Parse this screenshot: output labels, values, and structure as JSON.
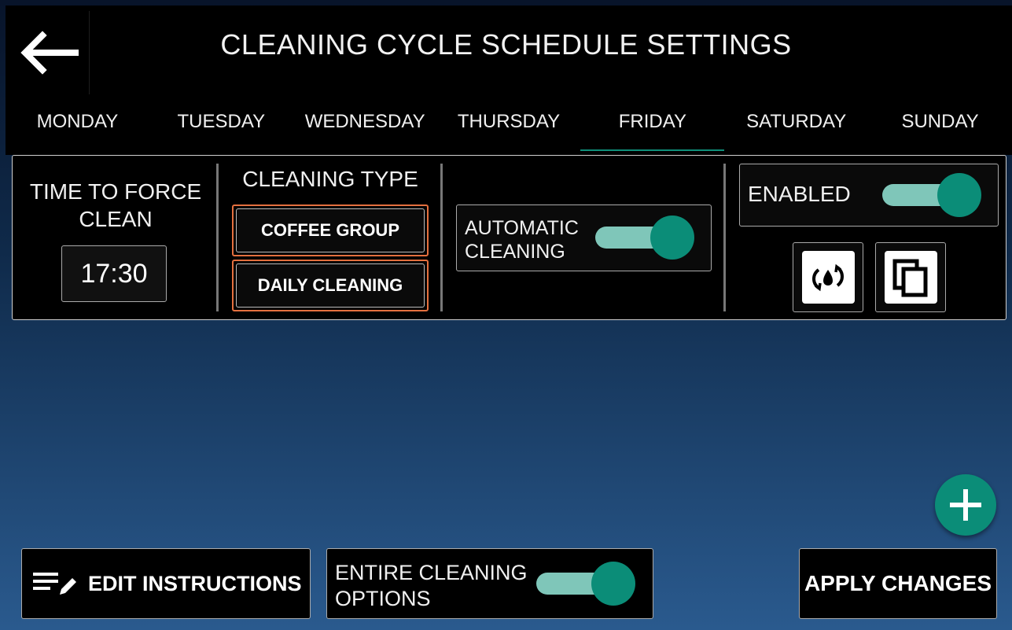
{
  "header": {
    "title": "CLEANING CYCLE SCHEDULE SETTINGS",
    "back_icon": "arrow-left-icon"
  },
  "tabs": [
    {
      "label": "MONDAY",
      "active": false
    },
    {
      "label": "TUESDAY",
      "active": false
    },
    {
      "label": "WEDNESDAY",
      "active": false
    },
    {
      "label": "THURSDAY",
      "active": false
    },
    {
      "label": "FRIDAY",
      "active": true
    },
    {
      "label": "SATURDAY",
      "active": false
    },
    {
      "label": "SUNDAY",
      "active": false
    }
  ],
  "schedule": {
    "force_clean_label": "TIME TO FORCE CLEAN",
    "force_clean_time": "17:30",
    "cleaning_type_label": "CLEANING TYPE",
    "cleaning_types": [
      "COFFEE GROUP",
      "DAILY CLEANING"
    ],
    "automatic_cleaning_label": "AUTOMATIC CLEANING",
    "automatic_cleaning_on": true,
    "enabled_label": "ENABLED",
    "enabled_on": true,
    "action_icons": [
      "water-cycle-icon",
      "copy-icon"
    ]
  },
  "footer": {
    "edit_label": "EDIT INSTRUCTIONS",
    "edit_icon": "edit-list-icon",
    "entire_label": "ENTIRE CLEANING OPTIONS",
    "entire_on": true,
    "apply_label": "APPLY CHANGES",
    "add_icon": "plus-icon"
  },
  "colors": {
    "accent": "#0b8d78",
    "toggle_track": "#7fc6b9",
    "selection_border": "#e4703f"
  }
}
